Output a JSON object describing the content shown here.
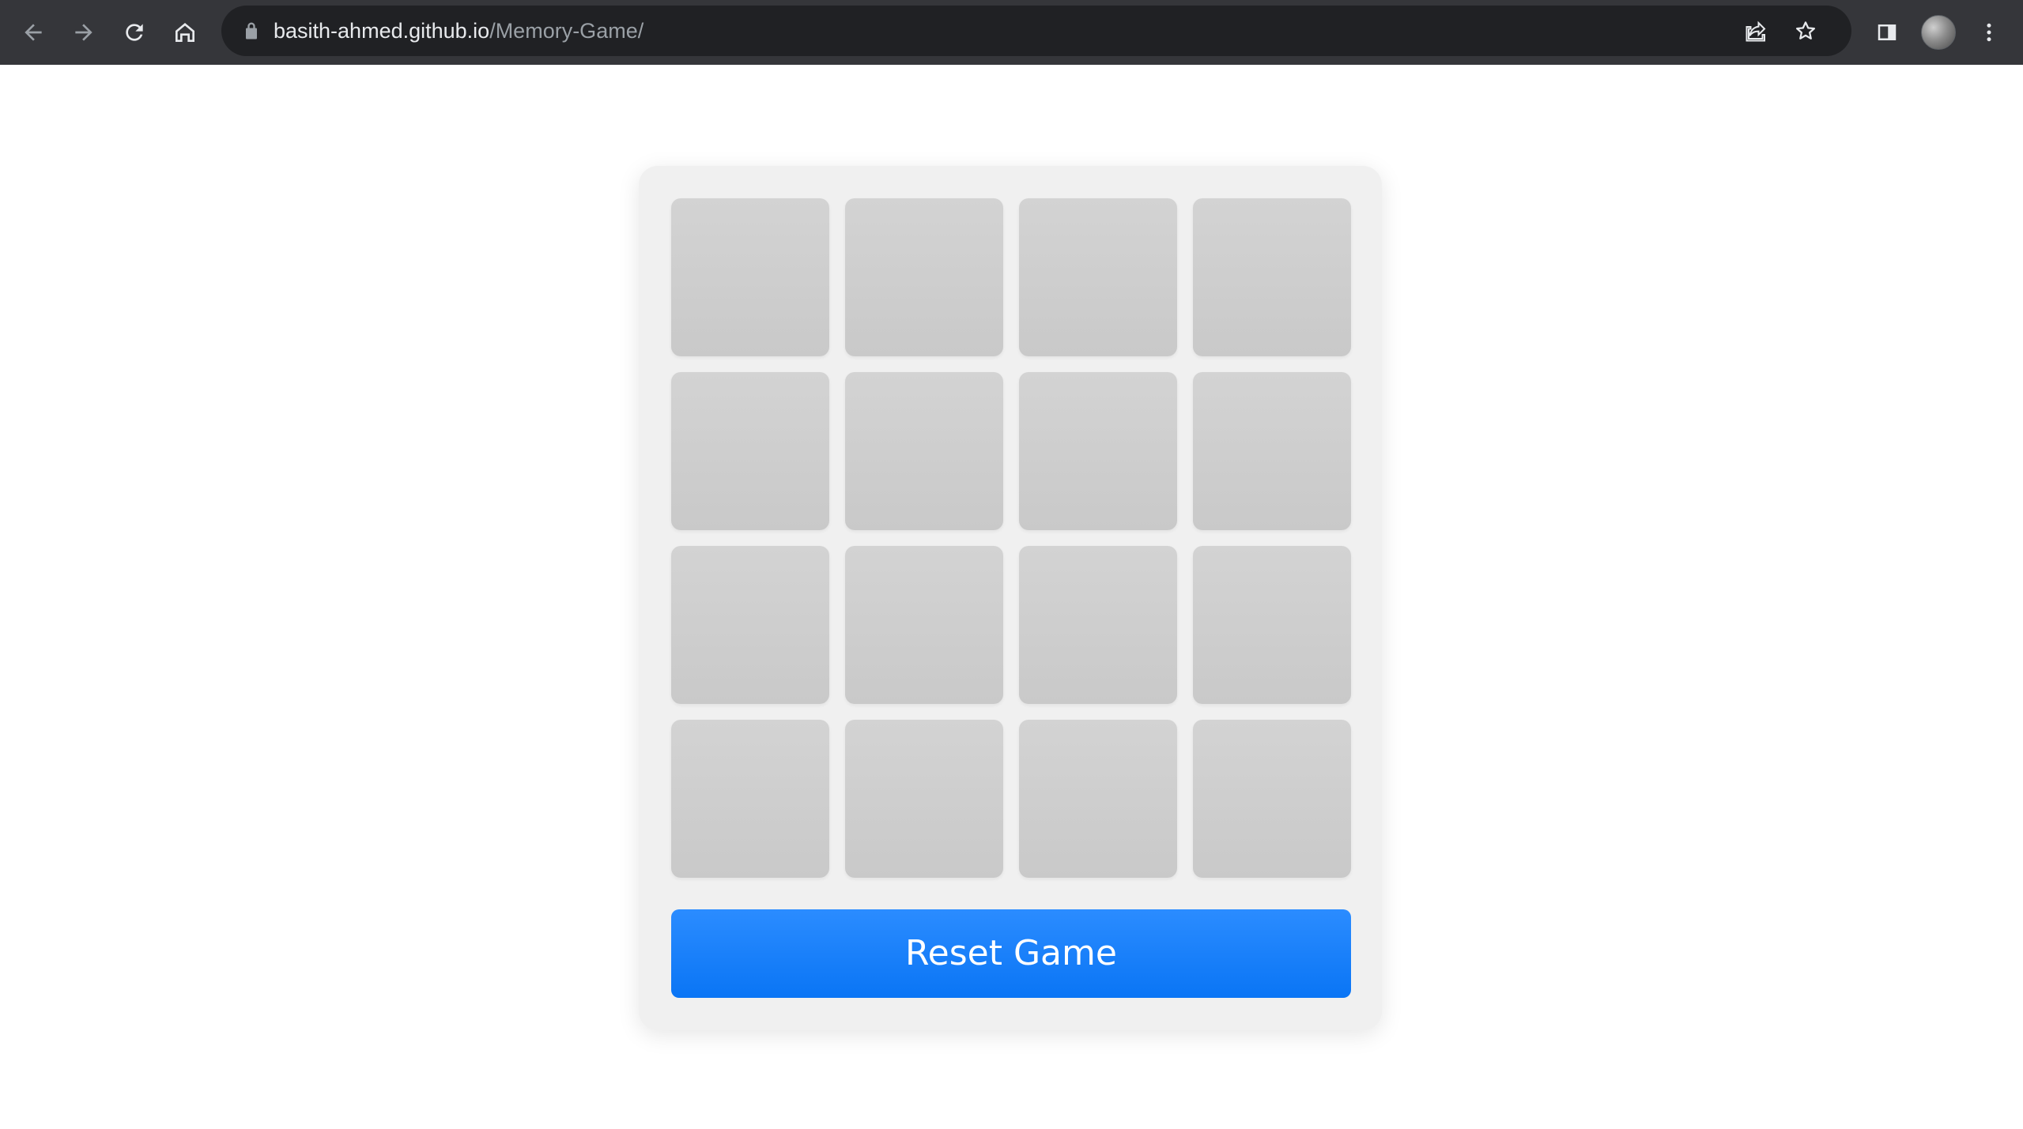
{
  "browser": {
    "url_host": "basith-ahmed.github.io",
    "url_path": "/Memory-Game/",
    "icons": [
      "back-arrow-icon",
      "forward-arrow-icon",
      "reload-icon",
      "home-icon",
      "lock-icon",
      "share-icon",
      "star-icon",
      "side-panel-icon",
      "profile-avatar",
      "kebab-menu-icon"
    ]
  },
  "game": {
    "rows": 4,
    "columns": 4,
    "cards": [
      "",
      "",
      "",
      "",
      "",
      "",
      "",
      "",
      "",
      "",
      "",
      "",
      "",
      "",
      "",
      ""
    ],
    "card_state": "face-down",
    "reset_label": "Reset Game"
  },
  "colors": {
    "browser_toolbar": "#35363a",
    "omnibox": "#202124",
    "container": "#f0f0f0",
    "card": "#cfcfcf",
    "reset_button": "#1a82ff",
    "reset_text": "#ffffff"
  }
}
